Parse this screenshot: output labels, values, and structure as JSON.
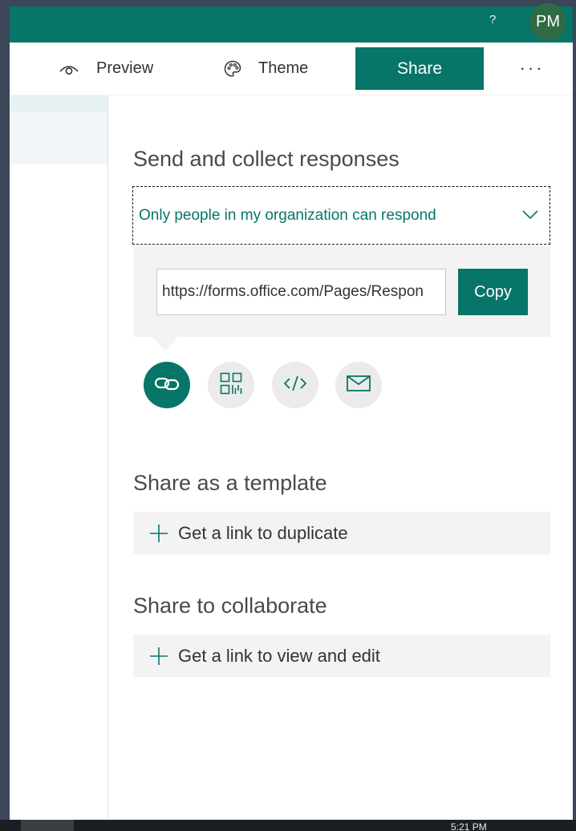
{
  "topbar": {
    "help_glyph": "?",
    "avatar_initials": "PM",
    "accent_color": "#077568"
  },
  "command_bar": {
    "preview_label": "Preview",
    "theme_label": "Theme",
    "share_label": "Share",
    "more_label": "···"
  },
  "send": {
    "title": "Send and collect responses",
    "permission_value": "Only people in my organization can respond",
    "link_url": "https://forms.office.com/Pages/Respon",
    "copy_label": "Copy",
    "options": [
      {
        "icon": "link-icon",
        "selected": true
      },
      {
        "icon": "qr-code-icon",
        "selected": false
      },
      {
        "icon": "embed-code-icon",
        "selected": false
      },
      {
        "icon": "email-icon",
        "selected": false
      }
    ]
  },
  "template": {
    "title": "Share as a template",
    "action_label": "Get a link to duplicate"
  },
  "collaborate": {
    "title": "Share to collaborate",
    "action_label": "Get a link to view and edit"
  },
  "taskbar": {
    "time": "5:21 PM"
  }
}
